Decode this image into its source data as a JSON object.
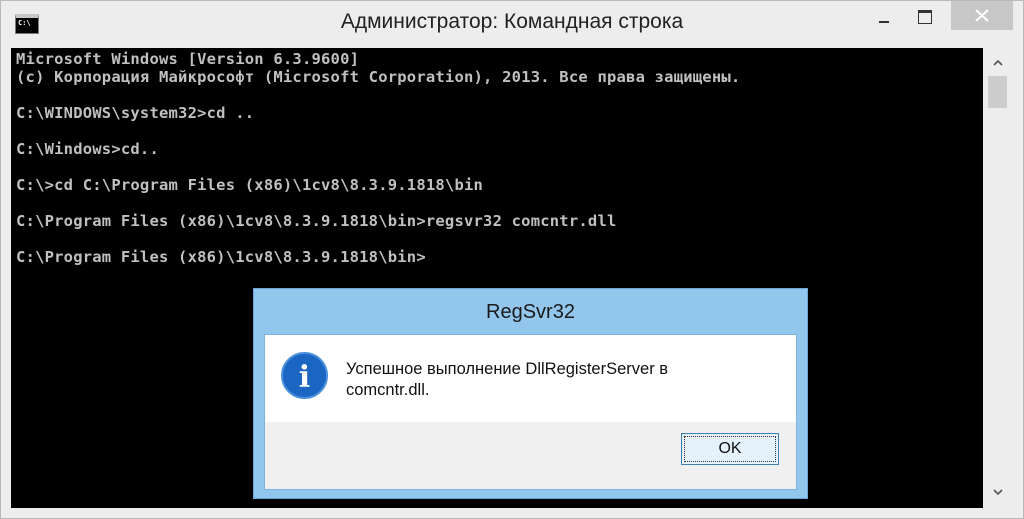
{
  "window": {
    "title": "Администратор: Командная строка",
    "icon": "cmd-icon",
    "icon_text": "C:\\"
  },
  "console": {
    "lines": [
      "Microsoft Windows [Version 6.3.9600]",
      "(c) Корпорация Майкрософт (Microsoft Corporation), 2013. Все права защищены.",
      "",
      "C:\\WINDOWS\\system32>cd ..",
      "",
      "C:\\Windows>cd..",
      "",
      "C:\\>cd C:\\Program Files (x86)\\1cv8\\8.3.9.1818\\bin",
      "",
      "C:\\Program Files (x86)\\1cv8\\8.3.9.1818\\bin>regsvr32 comcntr.dll",
      "",
      "C:\\Program Files (x86)\\1cv8\\8.3.9.1818\\bin>"
    ]
  },
  "dialog": {
    "title": "RegSvr32",
    "icon": "info-icon",
    "icon_glyph": "i",
    "message_line1": "Успешное выполнение DllRegisterServer в",
    "message_line2": "comcntr.dll.",
    "ok_label": "OK"
  },
  "colors": {
    "console_bg": "#000000",
    "console_text": "#c0c0c0",
    "dialog_frame": "#93c6ec",
    "info_blue": "#1a66c2"
  }
}
